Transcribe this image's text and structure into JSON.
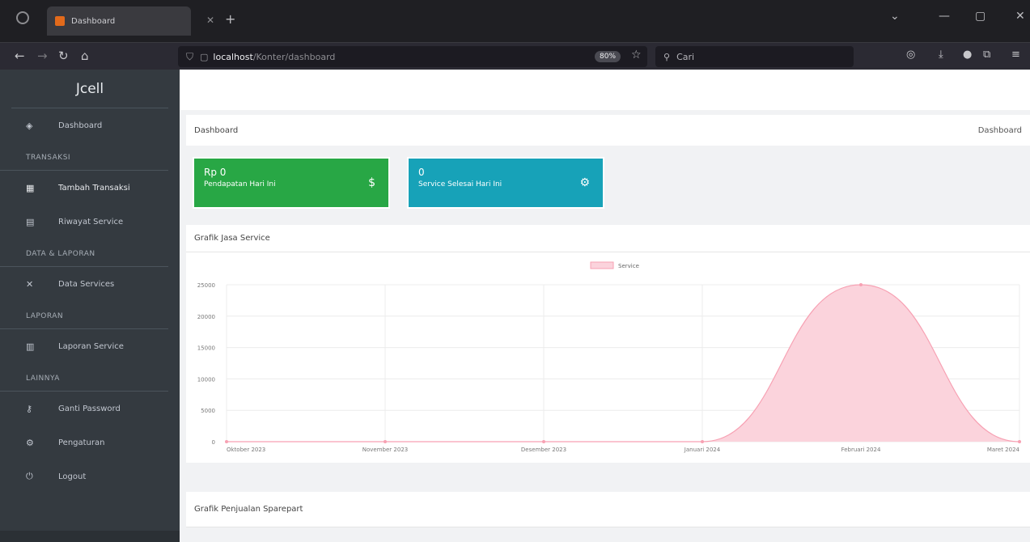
{
  "browser": {
    "tab_title": "Dashboard",
    "url_host": "localhost",
    "url_path": "/Konter/dashboard",
    "zoom": "80%",
    "search_placeholder": "Cari",
    "accent": "#e26a1b"
  },
  "sidebar": {
    "brand": "Jcell",
    "sections": [
      {
        "type": "item",
        "label": "Dashboard",
        "icon": "dashboard-icon",
        "glyph": "◈"
      },
      {
        "type": "header",
        "label": "TRANSAKSI"
      },
      {
        "type": "item",
        "label": "Tambah Transaksi",
        "icon": "cart-icon",
        "glyph": "▦",
        "bright": true
      },
      {
        "type": "item",
        "label": "Riwayat Service",
        "icon": "list-icon",
        "glyph": "▤"
      },
      {
        "type": "header",
        "label": "DATA & LAPORAN"
      },
      {
        "type": "item",
        "label": "Data Services",
        "icon": "tools-icon",
        "glyph": "✕"
      },
      {
        "type": "header",
        "label": "LAPORAN"
      },
      {
        "type": "item",
        "label": "Laporan Service",
        "icon": "report-icon",
        "glyph": "▥"
      },
      {
        "type": "header",
        "label": "LAINNYA"
      },
      {
        "type": "item",
        "label": "Ganti Password",
        "icon": "key-icon",
        "glyph": "⚷"
      },
      {
        "type": "item",
        "label": "Pengaturan",
        "icon": "gear-icon",
        "glyph": "⚙"
      },
      {
        "type": "item",
        "label": "Logout",
        "icon": "power-icon",
        "glyph": "⏻"
      }
    ]
  },
  "header": {
    "title": "Dashboard",
    "breadcrumb": "Dashboard"
  },
  "stats": [
    {
      "value": "Rp 0",
      "label": "Pendapatan Hari Ini",
      "icon": "money-icon",
      "glyph": "$",
      "color": "#28a745"
    },
    {
      "value": "0",
      "label": "Service Selesai Hari Ini",
      "icon": "gears-icon",
      "glyph": "⚙",
      "color": "#17a2b8"
    }
  ],
  "cards": {
    "service_chart_title": "Grafik Jasa Service",
    "sparepart_chart_title": "Grafik Penjualan Sparepart"
  },
  "chart_data": {
    "type": "area",
    "categories": [
      "Oktober 2023",
      "November 2023",
      "Desember 2023",
      "Januari 2024",
      "Februari 2024",
      "Maret 2024"
    ],
    "series": [
      {
        "name": "Service",
        "values": [
          0,
          0,
          0,
          0,
          25000,
          0
        ],
        "color": "#f7a1b3"
      }
    ],
    "ylim": [
      0,
      25000
    ],
    "yticks": [
      "0",
      "5000",
      "10000",
      "15000",
      "20000",
      "25000"
    ],
    "grid": true,
    "legend": "top"
  }
}
